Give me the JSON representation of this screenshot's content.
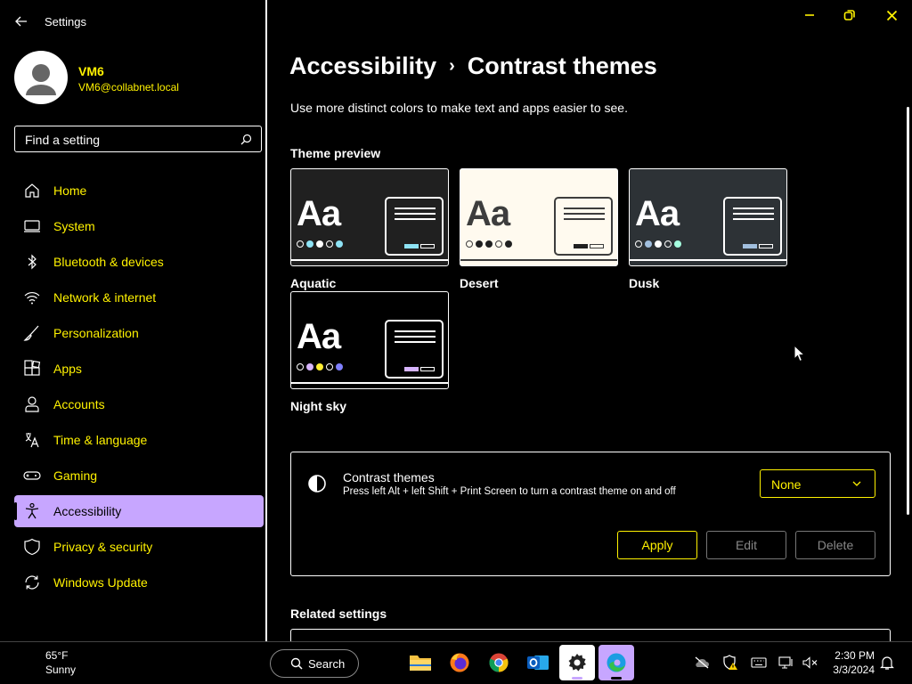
{
  "window": {
    "title": "Settings"
  },
  "user": {
    "name": "VM6",
    "email": "VM6@collabnet.local"
  },
  "search": {
    "placeholder": "Find a setting"
  },
  "sidebar": {
    "items": [
      {
        "label": "Home",
        "icon": "home-icon"
      },
      {
        "label": "System",
        "icon": "laptop-icon"
      },
      {
        "label": "Bluetooth & devices",
        "icon": "bluetooth-icon"
      },
      {
        "label": "Network & internet",
        "icon": "wifi-icon"
      },
      {
        "label": "Personalization",
        "icon": "brush-icon"
      },
      {
        "label": "Apps",
        "icon": "apps-icon"
      },
      {
        "label": "Accounts",
        "icon": "person-icon"
      },
      {
        "label": "Time & language",
        "icon": "clock-globe-icon"
      },
      {
        "label": "Gaming",
        "icon": "gamepad-icon"
      },
      {
        "label": "Accessibility",
        "icon": "accessibility-icon",
        "active": true
      },
      {
        "label": "Privacy & security",
        "icon": "shield-icon"
      },
      {
        "label": "Windows Update",
        "icon": "refresh-icon"
      }
    ]
  },
  "breadcrumb": {
    "parent": "Accessibility",
    "separator": "›",
    "current": "Contrast themes"
  },
  "description": "Use more distinct colors to make text and apps easier to see.",
  "preview": {
    "heading": "Theme preview",
    "themes": [
      {
        "name": "Aquatic",
        "sample": "Aa",
        "bg": "#202020",
        "fg": "#ffffff",
        "dots": [
          "#ffffff",
          "#8ee3f5",
          "#ffffff",
          "#ffffff",
          "#8ee3f5"
        ],
        "accent": "#8ee3f5"
      },
      {
        "name": "Desert",
        "sample": "Aa",
        "bg": "#fffaef",
        "fg": "#3d3d3d",
        "dots": [
          "#3d3d3d",
          "#202020",
          "#202020",
          "#3d3d3d",
          "#202020"
        ],
        "accent": "#202020"
      },
      {
        "name": "Dusk",
        "sample": "Aa",
        "bg": "#2d3236",
        "fg": "#ffffff",
        "dots": [
          "#ffffff",
          "#a1bfde",
          "#ffffff",
          "#ffffff",
          "#a6ffe0"
        ],
        "accent": "#a1bfde"
      },
      {
        "name": "Night sky",
        "sample": "Aa",
        "bg": "#000000",
        "fg": "#ffffff",
        "dots": [
          "#ffffff",
          "#d6b4fd",
          "#ffee32",
          "#ffffff",
          "#8080ff"
        ],
        "accent": "#d6b4fd"
      }
    ]
  },
  "contrast_themes": {
    "title": "Contrast themes",
    "subtitle": "Press left Alt + left Shift + Print Screen to turn a contrast theme on and off",
    "selected": "None",
    "apply_label": "Apply",
    "edit_label": "Edit",
    "delete_label": "Delete"
  },
  "related_settings": {
    "heading": "Related settings"
  },
  "taskbar": {
    "weather_temp": "65°F",
    "weather_condition": "Sunny",
    "search_label": "Search",
    "time": "2:30 PM",
    "date": "3/3/2024",
    "apps": [
      "file-explorer-icon",
      "firefox-icon",
      "chrome-icon",
      "outlook-icon",
      "settings-icon",
      "edge-icon"
    ]
  },
  "colors": {
    "accent": "#c7a6ff",
    "link_text": "#fff200",
    "background": "#000000",
    "text": "#ffffff"
  }
}
